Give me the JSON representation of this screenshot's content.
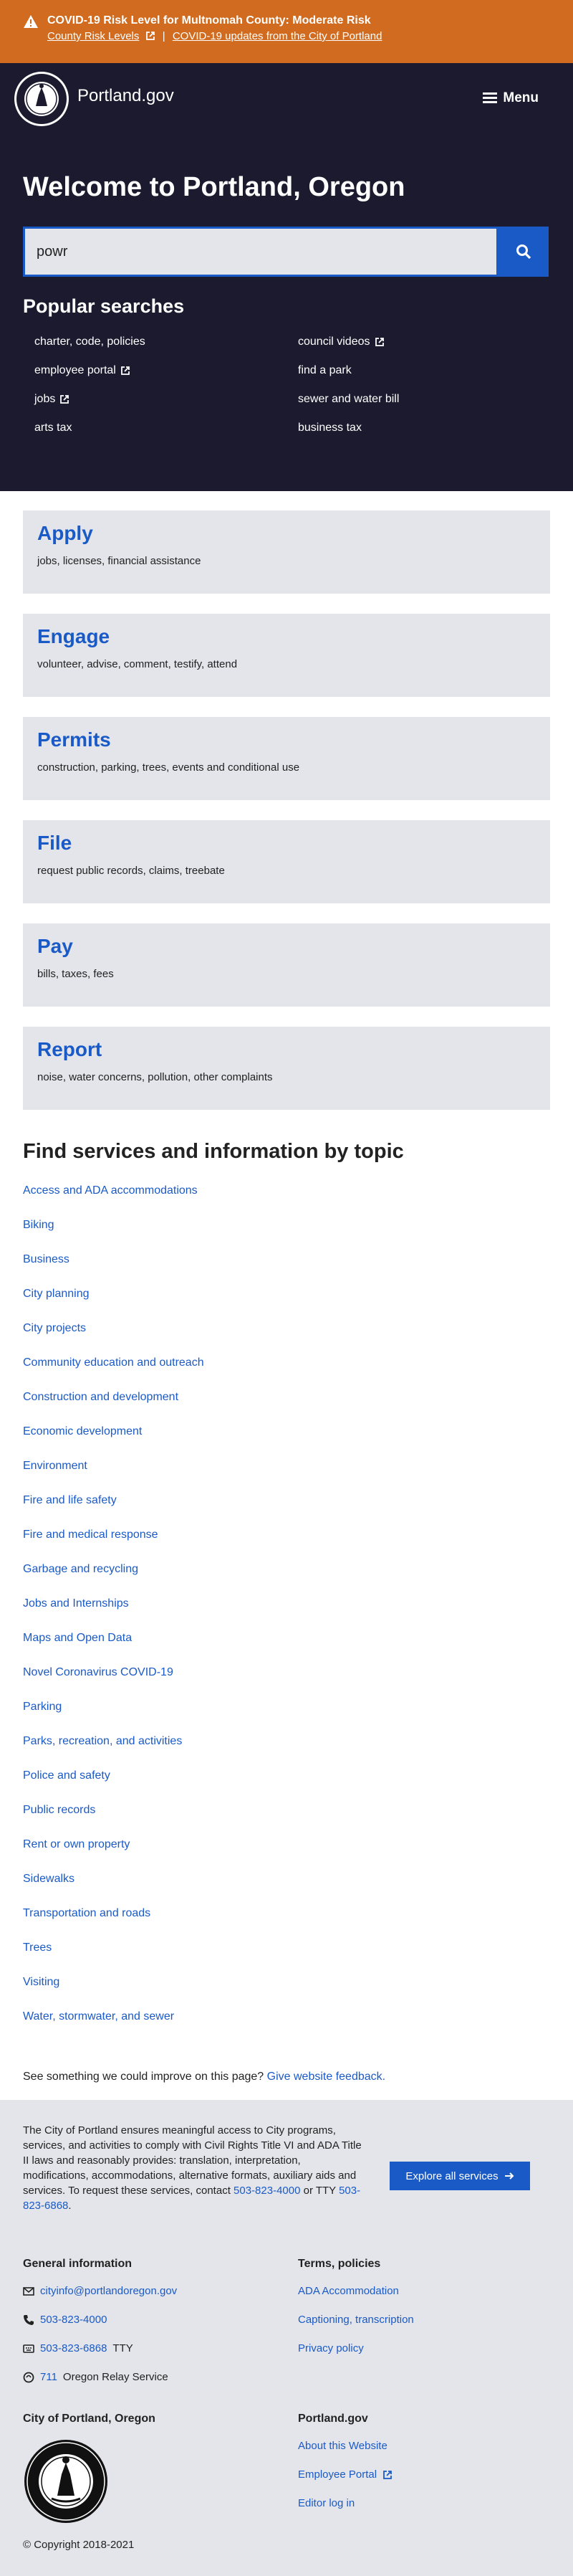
{
  "alert": {
    "title": "COVID-19 Risk Level for Multnomah County: Moderate Risk",
    "link1": "County Risk Levels",
    "separator": "|",
    "link2": "COVID-19 updates from the City of Portland"
  },
  "header": {
    "brand": "Portland.gov",
    "menu_label": "Menu"
  },
  "hero": {
    "title": "Welcome to Portland, Oregon",
    "search_value": "powr",
    "popular_heading": "Popular searches",
    "popular": [
      {
        "label": "charter, code, policies",
        "external": false
      },
      {
        "label": "council videos",
        "external": true
      },
      {
        "label": "employee portal",
        "external": true
      },
      {
        "label": "find a park",
        "external": false
      },
      {
        "label": "jobs",
        "external": true
      },
      {
        "label": "sewer and water bill",
        "external": false
      },
      {
        "label": "arts tax",
        "external": false
      },
      {
        "label": "business tax",
        "external": false
      }
    ]
  },
  "cards": [
    {
      "title": "Apply",
      "desc": "jobs, licenses, financial assistance"
    },
    {
      "title": "Engage",
      "desc": "volunteer, advise, comment, testify, attend"
    },
    {
      "title": "Permits",
      "desc": "construction, parking, trees, events and conditional use"
    },
    {
      "title": "File",
      "desc": "request public records, claims, treebate"
    },
    {
      "title": "Pay",
      "desc": "bills, taxes, fees"
    },
    {
      "title": "Report",
      "desc": "noise, water concerns, pollution, other complaints"
    }
  ],
  "topics": {
    "heading": "Find services and information by topic",
    "items": [
      "Access and ADA accommodations",
      "Biking",
      "Business",
      "City planning",
      "City projects",
      "Community education and outreach",
      "Construction and development",
      "Economic development",
      "Environment",
      "Fire and life safety",
      "Fire and medical response",
      "Garbage and recycling",
      "Jobs and Internships",
      "Maps and Open Data",
      "Novel Coronavirus COVID-19",
      "Parking",
      "Parks, recreation, and activities",
      "Police and safety",
      "Public records",
      "Rent or own property",
      "Sidewalks",
      "Transportation and roads",
      "Trees",
      "Visiting",
      "Water, stormwater, and sewer"
    ]
  },
  "feedback": {
    "text": "See something we could improve on this page?",
    "link": "Give website feedback."
  },
  "footer": {
    "intro": "The City of Portland ensures meaningful access to City programs, services, and activities to comply with Civil Rights Title VI and ADA Title II laws and reasonably provides: translation, interpretation, modifications, accommodations, alternative formats, auxiliary aids and services. To request these services, contact",
    "phone": "503-823-4000",
    "or_tty": "or TTY",
    "tty": "503-823-6868",
    "period": ".",
    "explore": "Explore all services",
    "general_heading": "General information",
    "email": "cityinfo@portlandoregon.gov",
    "phone2": "503-823-4000",
    "tty2": "503-823-6868",
    "tty_suffix": "TTY",
    "relay_num": "711",
    "relay_text": "Oregon Relay Service",
    "terms_heading": "Terms, policies",
    "terms": [
      "ADA Accommodation",
      "Captioning, transcription",
      "Privacy policy"
    ],
    "city_heading": "City of Portland, Oregon",
    "gov_heading": "Portland.gov",
    "gov_links": [
      "About this Website",
      "Employee Portal",
      "Editor log in"
    ],
    "copyright": "© Copyright 2018-2021"
  },
  "colors": {
    "alert": "#d06b1f",
    "hero": "#1c1a2e",
    "accent": "#1a5ac7",
    "card": "#e3e5ea"
  }
}
